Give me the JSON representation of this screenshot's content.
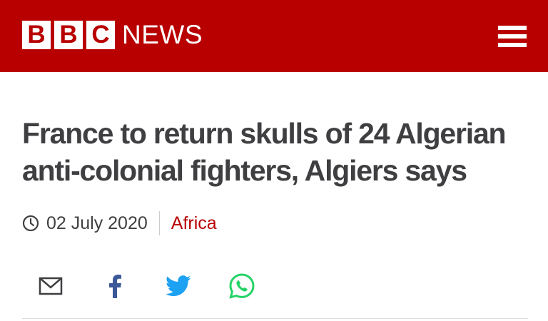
{
  "header": {
    "brand_letters": [
      "B",
      "B",
      "C"
    ],
    "brand_news": "NEWS",
    "background_color": "#b80000",
    "menu_icon": "hamburger-menu-icon"
  },
  "article": {
    "headline": "France to return skulls of 24 Algerian anti-colonial fighters, Algiers says",
    "date": "02 July 2020",
    "section": "Africa",
    "section_color": "#b80000"
  },
  "share": {
    "buttons": [
      {
        "icon": "email-icon"
      },
      {
        "icon": "facebook-icon",
        "color": "#3b5998"
      },
      {
        "icon": "twitter-icon",
        "color": "#1da1f2"
      },
      {
        "icon": "whatsapp-icon",
        "color": "#25d366"
      }
    ]
  }
}
